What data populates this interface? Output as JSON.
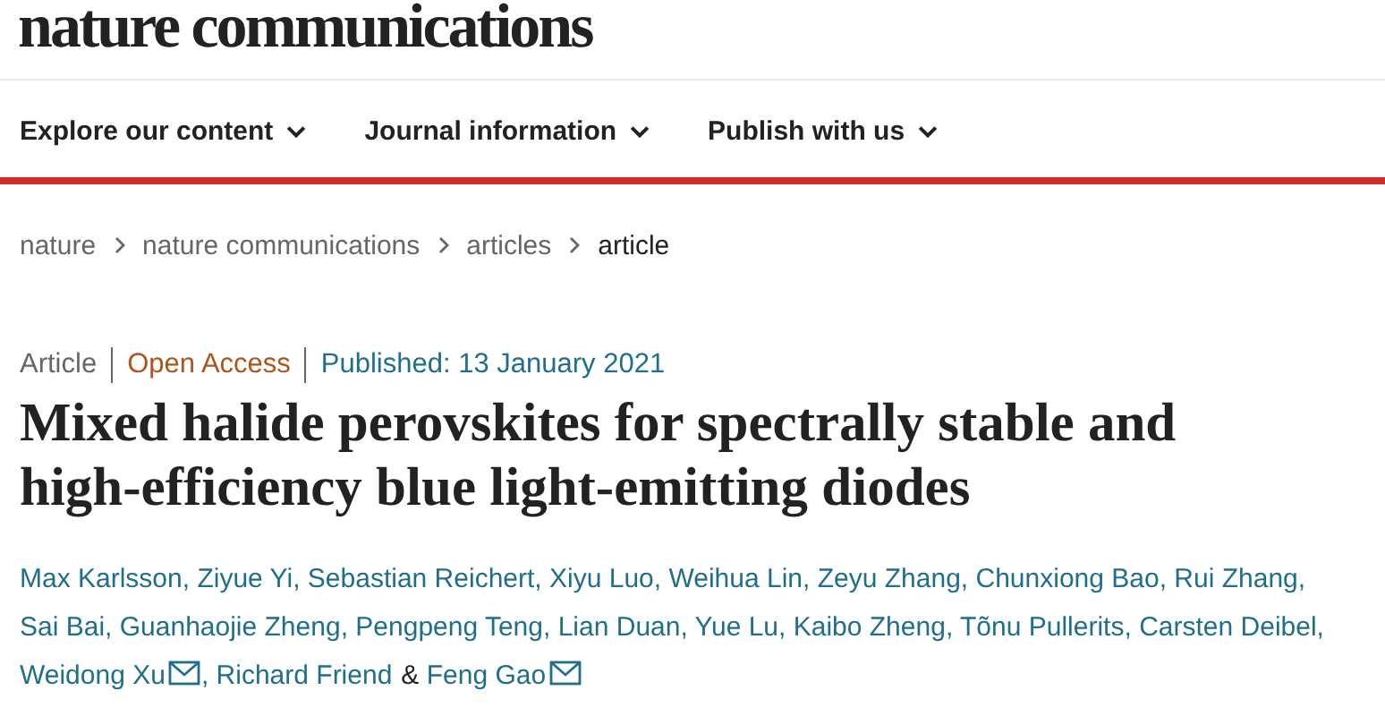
{
  "logo": "nature communications",
  "nav": [
    {
      "label": "Explore our content"
    },
    {
      "label": "Journal information"
    },
    {
      "label": "Publish with us"
    }
  ],
  "breadcrumbs": [
    {
      "label": "nature",
      "current": false
    },
    {
      "label": "nature communications",
      "current": false
    },
    {
      "label": "articles",
      "current": false
    },
    {
      "label": "article",
      "current": true
    }
  ],
  "meta": [
    {
      "kind": "type",
      "text": "Article"
    },
    {
      "kind": "access",
      "text": "Open Access"
    },
    {
      "kind": "date",
      "text": "Published: 13 January 2021"
    }
  ],
  "title": "Mixed halide perovskites for spectrally stable and high-efficiency blue light-emitting diodes",
  "authors": [
    {
      "name": "Max Karlsson",
      "mail": false,
      "sep": ","
    },
    {
      "name": "Ziyue Yi",
      "mail": false,
      "sep": ","
    },
    {
      "name": "Sebastian Reichert",
      "mail": false,
      "sep": ","
    },
    {
      "name": "Xiyu Luo",
      "mail": false,
      "sep": ","
    },
    {
      "name": "Weihua Lin",
      "mail": false,
      "sep": ","
    },
    {
      "name": "Zeyu Zhang",
      "mail": false,
      "sep": ","
    },
    {
      "name": "Chunxiong Bao",
      "mail": false,
      "sep": ","
    },
    {
      "name": "Rui Zhang",
      "mail": false,
      "sep": ","
    },
    {
      "name": "Sai Bai",
      "mail": false,
      "sep": ","
    },
    {
      "name": "Guanhaojie Zheng",
      "mail": false,
      "sep": ","
    },
    {
      "name": "Pengpeng Teng",
      "mail": false,
      "sep": ","
    },
    {
      "name": "Lian Duan",
      "mail": false,
      "sep": ","
    },
    {
      "name": "Yue Lu",
      "mail": false,
      "sep": ","
    },
    {
      "name": "Kaibo Zheng",
      "mail": false,
      "sep": ","
    },
    {
      "name": "Tõnu Pullerits",
      "mail": false,
      "sep": ","
    },
    {
      "name": "Carsten Deibel",
      "mail": false,
      "sep": ","
    },
    {
      "name": "Weidong Xu",
      "mail": true,
      "sep": ","
    },
    {
      "name": "Richard Friend",
      "mail": false,
      "sep": "&"
    },
    {
      "name": "Feng Gao",
      "mail": true
    }
  ]
}
